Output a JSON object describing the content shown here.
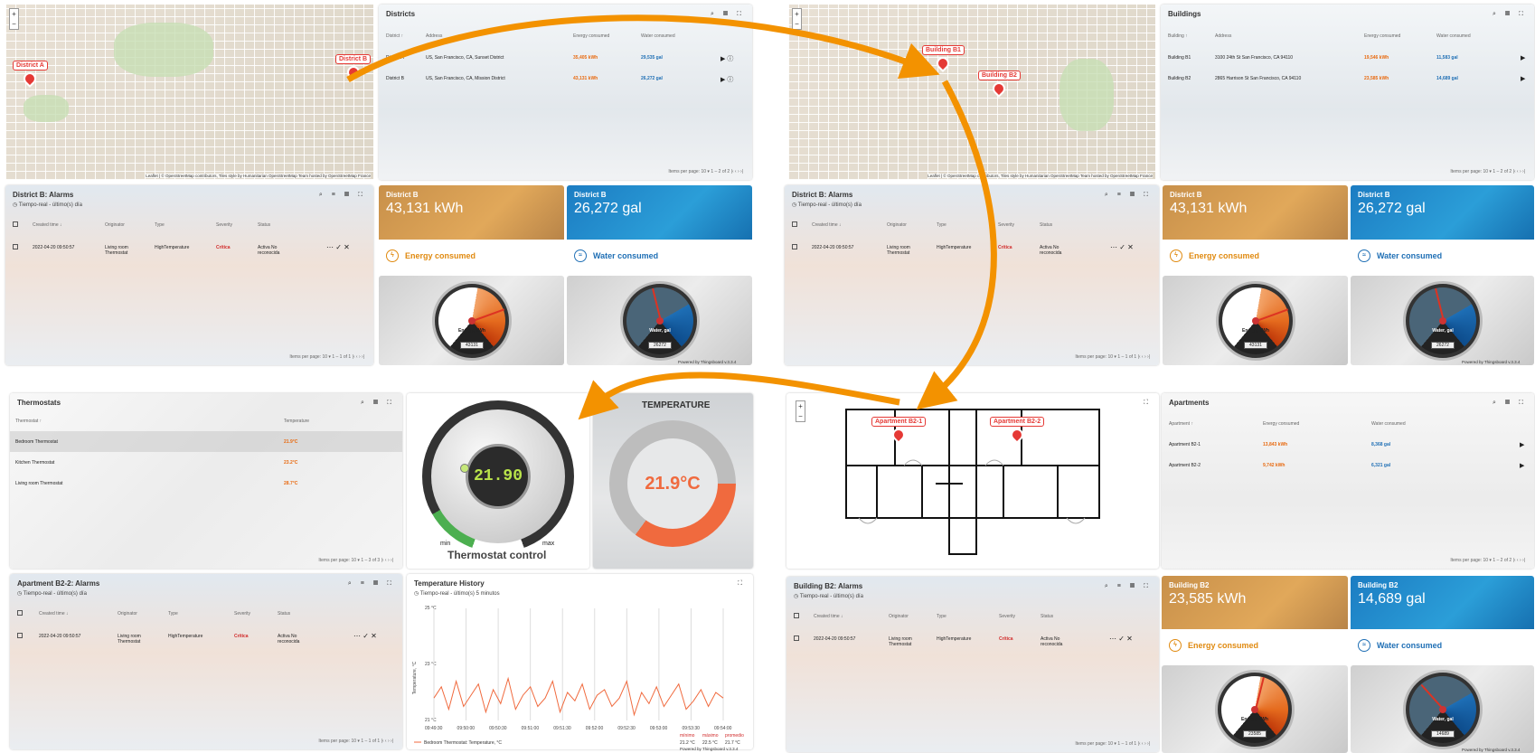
{
  "q1": {
    "map": {
      "zoom_in": "+",
      "zoom_out": "−",
      "pins": [
        "District A",
        "District B"
      ],
      "attribution": "Leaflet | © OpenStreetMap contributors, Tiles style by Humanitarian OpenStreetMap Team hosted by OpenStreetMap France"
    },
    "districts": {
      "title": "Districts",
      "headers": [
        "District ↑",
        "Address",
        "Energy consumed",
        "Water consumed"
      ],
      "rows": [
        {
          "name": "District A",
          "address": "US, San Francisco, CA, Sunset District",
          "energy": "35,405 kWh",
          "water": "29,535 gal"
        },
        {
          "name": "District B",
          "address": "US, San Francisco, CA, Mission District",
          "energy": "43,131 kWh",
          "water": "26,272 gal"
        }
      ],
      "pager": "Items per page: 10 ▾     1 – 2 of 2     |‹   ‹   ›   ›|"
    },
    "alarms": {
      "title": "District B: Alarms",
      "timewindow": "Tiempo-real - último(s) día",
      "headers": [
        "Created time ↓",
        "Originator",
        "Type",
        "Severity",
        "Status"
      ],
      "row": {
        "time": "2022-04-20 09:50:57",
        "originator": "Living room Thermostat",
        "type": "HighTemperature",
        "severity": "Crítica",
        "status": "Activa No reconocida"
      },
      "pager": "Items per page: 10 ▾     1 – 1 of 1     |‹   ‹   ›   ›|"
    },
    "energy": {
      "name": "District B",
      "value": "43,131 kWh",
      "label": "Energy consumed"
    },
    "water": {
      "name": "District B",
      "value": "26,272 gal",
      "label": "Water consumed"
    },
    "gauge_e": {
      "label": "Energy, kWh",
      "value": "43131",
      "level": 0.75
    },
    "gauge_w": {
      "label": "Water, gal",
      "value": "26272",
      "level": 0.45
    },
    "powered": "Powered by Thingsboard v.3.3.4"
  },
  "q2": {
    "map": {
      "pins": [
        "Building B1",
        "Building B2"
      ],
      "attribution": "Leaflet | © OpenStreetMap contributors, Tiles style by Humanitarian OpenStreetMap Team hosted by OpenStreetMap France"
    },
    "buildings": {
      "title": "Buildings",
      "headers": [
        "Building ↑",
        "Address",
        "Energy consumed",
        "Water consumed"
      ],
      "rows": [
        {
          "name": "Building B1",
          "address": "3100 24th St San Francisco, CA 94110",
          "energy": "19,546 kWh",
          "water": "11,583 gal"
        },
        {
          "name": "Building B2",
          "address": "2865 Harrison St San Francisco, CA 94110",
          "energy": "23,585 kWh",
          "water": "14,689 gal"
        }
      ],
      "pager": "Items per page: 10 ▾     1 – 2 of 2     |‹   ‹   ›   ›|"
    },
    "alarms": {
      "title": "District B: Alarms",
      "timewindow": "Tiempo-real - último(s) día",
      "row": {
        "time": "2022-04-20 09:50:57",
        "originator": "Living room Thermostat",
        "type": "HighTemperature",
        "severity": "Crítica",
        "status": "Activa No reconocida"
      },
      "pager": "Items per page: 10 ▾     1 – 1 of 1     |‹   ‹   ›   ›|"
    },
    "energy": {
      "name": "District B",
      "value": "43,131 kWh",
      "label": "Energy consumed"
    },
    "water": {
      "name": "District B",
      "value": "26,272 gal",
      "label": "Water consumed"
    },
    "gauge_e": {
      "label": "Energy, kWh",
      "value": "43131",
      "level": 0.75
    },
    "gauge_w": {
      "label": "Water, gal",
      "value": "26272",
      "level": 0.45
    },
    "powered": "Powered by Thingsboard v.3.3.4"
  },
  "q3": {
    "thermostats": {
      "title": "Thermostats",
      "headers": [
        "Thermostat ↑",
        "Temperature"
      ],
      "rows": [
        {
          "name": "Bedroom Thermostat",
          "temp": "21.9°C"
        },
        {
          "name": "Kitchen Thermostat",
          "temp": "23.2°C"
        },
        {
          "name": "Living room Thermostat",
          "temp": "28.7°C"
        }
      ],
      "pager": "Items per page: 10 ▾     1 – 3 of 3     |‹   ‹   ›   ›|"
    },
    "dial": {
      "value": "21.90",
      "min": "min",
      "max": "max",
      "title": "Thermostat control"
    },
    "temperature": {
      "title": "TEMPERATURE",
      "value": "21.9°C",
      "level": 0.35
    },
    "alarms": {
      "title": "Apartment B2-2: Alarms",
      "timewindow": "Tiempo-real - último(s) día",
      "row": {
        "time": "2022-04-20 09:50:57",
        "originator": "Living room Thermostat",
        "type": "HighTemperature",
        "severity": "Crítica",
        "status": "Activa No reconocida"
      },
      "pager": "Items per page: 10 ▾     1 – 1 of 1     |‹   ‹   ›   ›|"
    },
    "history": {
      "title": "Temperature History",
      "timewindow": "Tiempo-real - último(s) 5 minutos",
      "ylabel": "Temperature, °C",
      "yticks": [
        "25 °C",
        "23 °C",
        "21 °C"
      ],
      "xticks": [
        "09:49:30",
        "09:50:00",
        "09:50:30",
        "09:51:00",
        "09:51:30",
        "09:52:00",
        "09:52:30",
        "09:53:00",
        "09:53:30",
        "09:54:00"
      ],
      "legend": "Bedroom Thermostat: Temperature, °C",
      "stats": {
        "min_label": "mínimo",
        "max_label": "máximo",
        "avg_label": "promedio",
        "min": "21.2 °C",
        "max": "22.5 °C",
        "avg": "21.7 °C"
      }
    },
    "powered": "Powered by Thingsboard v.3.3.4"
  },
  "q4": {
    "plan": {
      "pins": [
        "Apartment B2-1",
        "Apartment B2-2"
      ]
    },
    "apartments": {
      "title": "Apartments",
      "headers": [
        "Apartment ↑",
        "Energy consumed",
        "Water consumed"
      ],
      "rows": [
        {
          "name": "Apartment B2-1",
          "energy": "13,843 kWh",
          "water": "8,368 gal"
        },
        {
          "name": "Apartment B2-2",
          "energy": "9,742 kWh",
          "water": "6,321 gal"
        }
      ],
      "pager": "Items per page: 10 ▾     1 – 2 of 2     |‹   ‹   ›   ›|"
    },
    "alarms": {
      "title": "Building B2: Alarms",
      "timewindow": "Tiempo-real - último(s) día",
      "row": {
        "time": "2022-04-20 09:50:57",
        "originator": "Living room Thermostat",
        "type": "HighTemperature",
        "severity": "Crítica",
        "status": "Activa No reconocida"
      },
      "pager": "Items per page: 10 ▾     1 – 1 of 1     |‹   ‹   ›   ›|"
    },
    "energy": {
      "name": "Building B2",
      "value": "23,585 kWh",
      "label": "Energy consumed"
    },
    "water": {
      "name": "Building B2",
      "value": "14,689 gal",
      "label": "Water consumed"
    },
    "gauge_e": {
      "label": "Energy, kWh",
      "value": "23585",
      "level": 0.55
    },
    "gauge_w": {
      "label": "Water, gal",
      "value": "14689",
      "level": 0.35
    },
    "powered": "Powered by Thingsboard v.3.3.4"
  },
  "colors": {
    "accent": "#f39200",
    "critical": "#d12b2b",
    "energy": "#e86a10",
    "water": "#1f6fb5"
  },
  "chart_data": {
    "type": "line",
    "title": "Temperature History",
    "ylabel": "Temperature, °C",
    "ylim": [
      21,
      25
    ],
    "x": [
      "09:49:30",
      "09:50:00",
      "09:50:30",
      "09:51:00",
      "09:51:30",
      "09:52:00",
      "09:52:30",
      "09:53:00",
      "09:53:30",
      "09:54:00"
    ],
    "series": [
      {
        "name": "Bedroom Thermostat: Temperature, °C",
        "values": [
          21.8,
          22.2,
          21.4,
          22.4,
          21.5,
          21.9,
          22.3,
          21.3,
          22.1,
          21.6,
          22.5,
          21.4,
          21.9,
          22.2,
          21.5,
          21.8,
          22.4,
          21.3,
          22.0,
          21.7,
          22.3,
          21.4,
          21.9,
          22.1,
          21.5,
          21.8,
          22.4,
          21.2,
          22.0,
          21.6,
          22.2,
          21.5,
          21.9,
          22.3,
          21.4,
          21.7,
          22.1,
          21.5,
          22.0,
          21.8
        ]
      }
    ]
  }
}
